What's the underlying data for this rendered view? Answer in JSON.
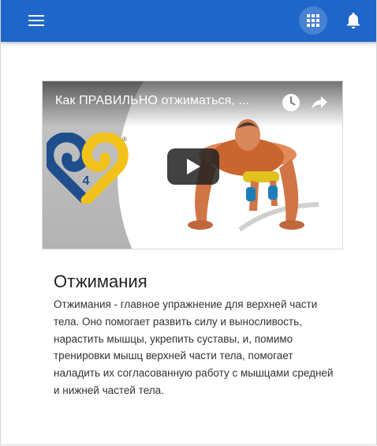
{
  "colors": {
    "appbar": "#1e66c8",
    "logo_blue": "#1f4e8c",
    "logo_yellow": "#f2c21b"
  },
  "appbar": {
    "menu_icon": "hamburger-menu-icon",
    "apps_icon": "apps-grid-icon",
    "notifications_icon": "bell-icon"
  },
  "video": {
    "title": "Как ПРАВИЛЬНО отжиматься, ...",
    "logo_number": "4",
    "logo_mark": "®",
    "icons": [
      "clock-icon",
      "share-icon",
      "play-icon"
    ]
  },
  "exercise": {
    "title": "Отжимания",
    "description": "Отжимания - главное упражнение для верхней части тела. Оно помогает развить силу и выносливость, нарастить мышцы, укрепить суставы, и, помимо тренировки мышц верхней части тела, помогает наладить их согласованную работу с мышцами средней и нижней частей тела."
  }
}
